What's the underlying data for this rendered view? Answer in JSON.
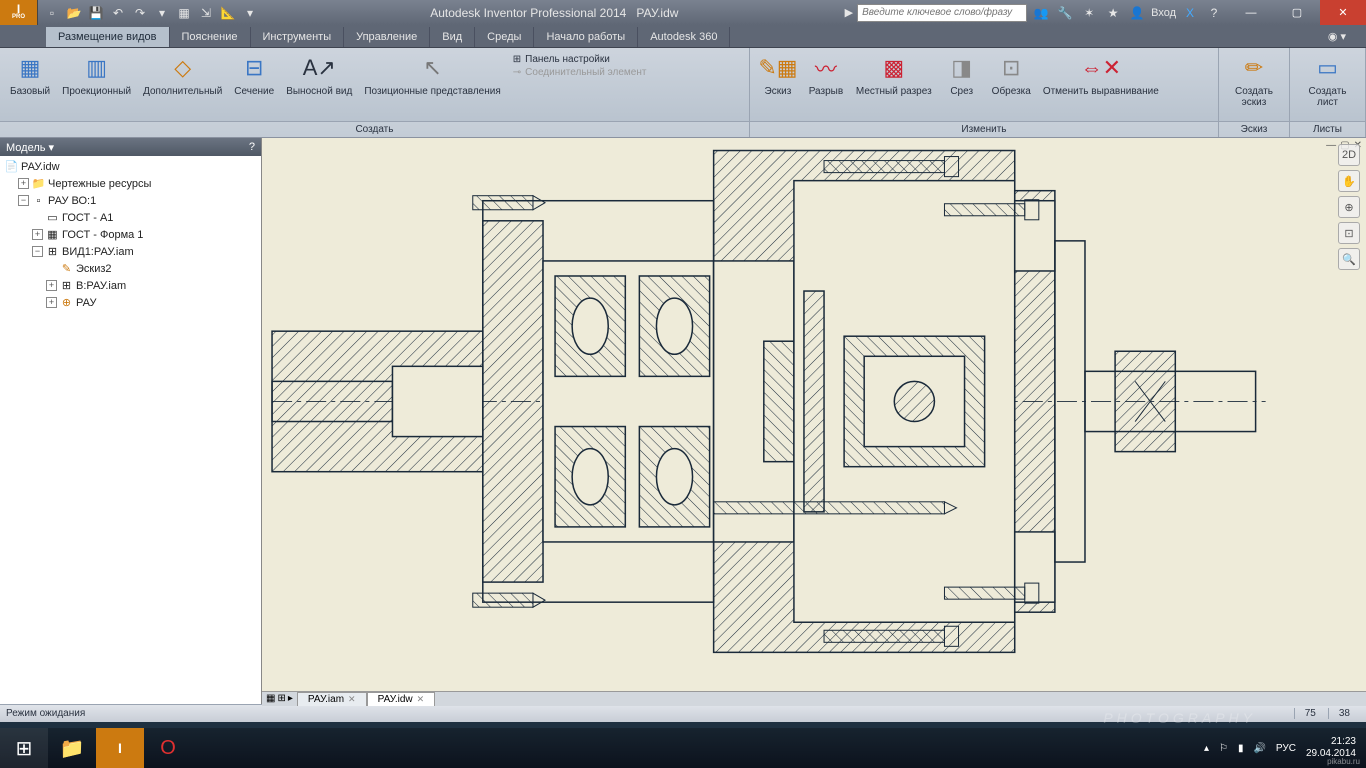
{
  "title": {
    "app": "Autodesk Inventor Professional 2014",
    "file": "РАУ.idw"
  },
  "logo": {
    "i": "I",
    "pro": "PRO"
  },
  "search_placeholder": "Введите ключевое слово/фразу",
  "signin": "Вход",
  "tabs": [
    "Размещение видов",
    "Пояснение",
    "Инструменты",
    "Управление",
    "Вид",
    "Среды",
    "Начало работы",
    "Autodesk 360"
  ],
  "ribbon": {
    "create": {
      "label": "Создать",
      "items": [
        "Базовый",
        "Проекционный",
        "Дополнительный",
        "Сечение",
        "Выносной вид",
        "Позиционные представления"
      ]
    },
    "small": {
      "a": "Панель настройки",
      "b": "Соединительный элемент"
    },
    "edit": {
      "label": "Изменить",
      "items": [
        "Эскиз",
        "Разрыв",
        "Местный разрез",
        "Срез",
        "Обрезка",
        "Отменить выравнивание"
      ]
    },
    "sketch": {
      "label": "Эскиз",
      "item": "Создать эскиз"
    },
    "sheet": {
      "label": "Листы",
      "item": "Создать лист"
    }
  },
  "model": {
    "header": "Модель",
    "root": "РАУ.idw",
    "res": "Чертежные ресурсы",
    "sheet": "РАУ ВО:1",
    "gost_a1": "ГОСТ - А1",
    "gost_f1": "ГОСТ - Форма 1",
    "view": "ВИД1:РАУ.iam",
    "sketch": "Эскиз2",
    "viewb": "В:РАУ.iam",
    "rau": "РАУ"
  },
  "doc_tabs": [
    "РАУ.iam",
    "РАУ.idw"
  ],
  "status": {
    "text": "Режим ожидания",
    "a": "75",
    "b": "38"
  },
  "task": {
    "lang": "РУС",
    "time": "21:23",
    "date": "29.04.2014"
  },
  "watermark": "PHOTOGRAPHY",
  "site": "pikabu.ru"
}
